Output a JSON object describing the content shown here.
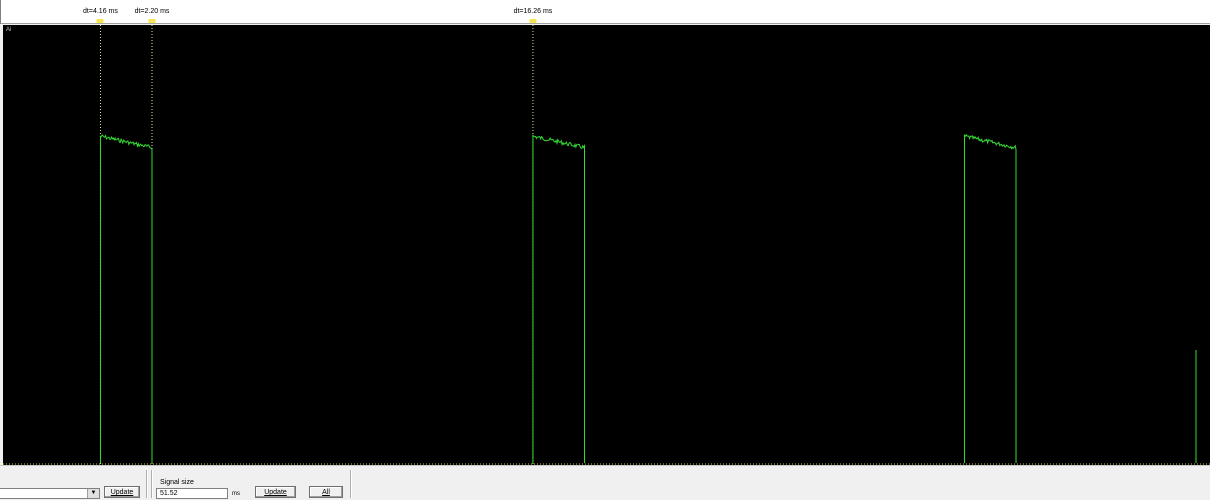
{
  "ruler": {
    "cursors": [
      {
        "label": "dt=4.16 ms",
        "time_ms": 4.16
      },
      {
        "label": "dt=2.20 ms",
        "time_ms": 6.36
      },
      {
        "label": "dt=16.26 ms",
        "time_ms": 22.62
      }
    ]
  },
  "plot": {
    "channel_label": "Ai",
    "background": "#000000",
    "trace_color": "#33dd33",
    "grid_color": "#c8c83c"
  },
  "toolbar": {
    "channel_select_value": "",
    "update_label_1": "Update",
    "signal_size_label": "Signal size",
    "signal_size_value": "51.52",
    "signal_size_unit": "ms",
    "update_label_2": "Update",
    "all_label": "All"
  },
  "chart_data": {
    "type": "line",
    "title": "",
    "xlabel": "",
    "ylabel": "",
    "xlim": [
      0,
      51.52
    ],
    "pulses": [
      {
        "start_ms": 4.16,
        "end_ms": 6.36,
        "top_level_start": 0.86,
        "top_level_end": 0.83
      },
      {
        "start_ms": 22.62,
        "end_ms": 24.82,
        "top_level_start": 0.86,
        "top_level_end": 0.83
      },
      {
        "start_ms": 41.04,
        "end_ms": 43.24,
        "top_level_start": 0.86,
        "top_level_end": 0.83
      }
    ],
    "baseline_level": 0.0,
    "grid": false
  }
}
